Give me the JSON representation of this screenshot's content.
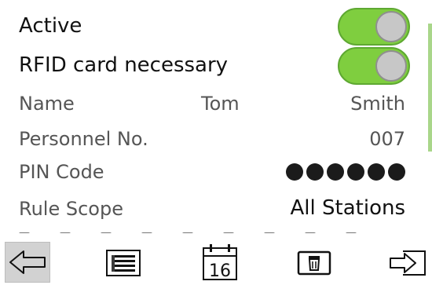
{
  "settings": {
    "active_label": "Active",
    "rfid_label": "RFID card necessary",
    "name_label": "Name",
    "first_name": "Tom",
    "last_name": "Smith",
    "personnel_label": "Personnel No.",
    "personnel_value": "007",
    "pin_label": "PIN Code",
    "rule_scope_label": "Rule Scope",
    "rule_scope_value": "All Stations"
  },
  "toggles": {
    "active_on": true,
    "rfid_on": true
  },
  "pin": {
    "masked_digits": 6
  },
  "toolbar": {
    "calendar_day": "16",
    "buttons": [
      "back-arrow-icon",
      "list-icon",
      "calendar-icon",
      "trash-icon",
      "exit-icon"
    ]
  },
  "colors": {
    "toggle_on": "#7fce3f",
    "toggle_border": "#5ea832",
    "knob": "#c7c7c7",
    "selected_button": "#d2d2d2",
    "accent": "#a9d68a"
  }
}
